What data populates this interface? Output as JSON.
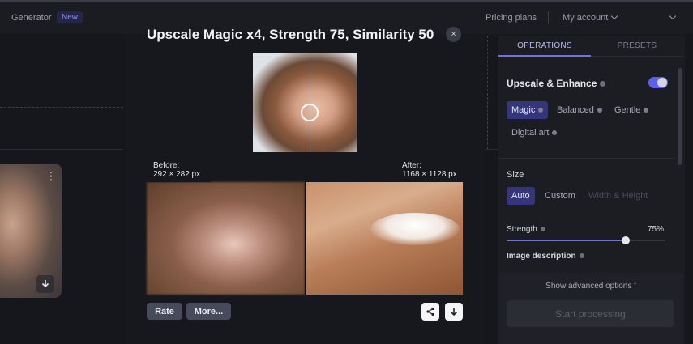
{
  "topbar": {
    "generator": "Generator",
    "new_badge": "New",
    "pricing": "Pricing plans",
    "account": "My account"
  },
  "modal": {
    "title": "Upscale Magic x4, Strength 75, Similarity 50",
    "close_label": "×",
    "before_label": "Before:",
    "before_size": "292 × 282 px",
    "after_label": "After:",
    "after_size": "1168 × 1128 px",
    "rate_button": "Rate",
    "more_button": "More..."
  },
  "panel": {
    "tabs": [
      {
        "label": "OPERATIONS",
        "active": true
      },
      {
        "label": "PRESETS",
        "active": false
      }
    ],
    "upscale_title": "Upscale & Enhance",
    "upscale_enabled": true,
    "modes": [
      {
        "label": "Magic",
        "active": true
      },
      {
        "label": "Balanced",
        "active": false
      },
      {
        "label": "Gentle",
        "active": false
      },
      {
        "label": "Digital art",
        "active": false
      }
    ],
    "size_label": "Size",
    "size_options": [
      {
        "label": "Auto",
        "active": true
      },
      {
        "label": "Custom",
        "active": false
      },
      {
        "label": "Width & Height",
        "disabled": true
      }
    ],
    "strength_label": "Strength",
    "strength_value": "75%",
    "strength_fraction": 0.75,
    "image_description_label": "Image description",
    "advanced_options": "Show advanced options",
    "start_button": "Start processing"
  },
  "colors": {
    "accent": "#6e6fe8",
    "active_chip": "#34357a",
    "background": "#16171c"
  }
}
